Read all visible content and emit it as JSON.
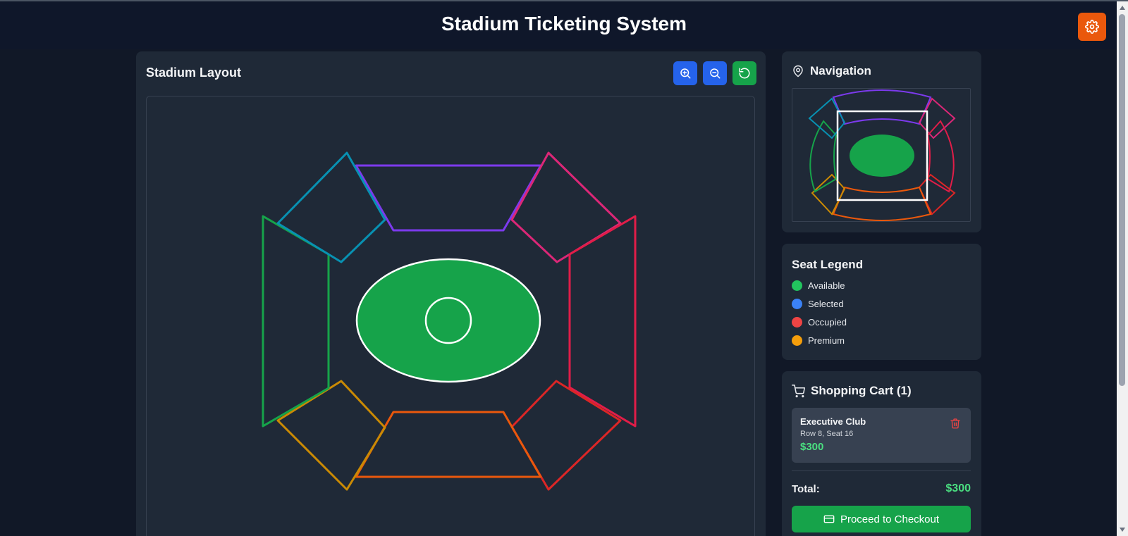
{
  "app": {
    "title": "Stadium Ticketing System"
  },
  "layout": {
    "title": "Stadium Layout",
    "controls": {
      "zoom_in": "zoom-in-icon",
      "zoom_out": "zoom-out-icon",
      "reset": "reset-icon"
    }
  },
  "navigation": {
    "title": "Navigation",
    "icon": "map-pin-icon"
  },
  "legend": {
    "title": "Seat Legend",
    "items": [
      {
        "label": "Available",
        "color": "#22c55e"
      },
      {
        "label": "Selected",
        "color": "#3b82f6"
      },
      {
        "label": "Occupied",
        "color": "#ef4444"
      },
      {
        "label": "Premium",
        "color": "#f59e0b"
      }
    ]
  },
  "cart": {
    "title": "Shopping Cart (1)",
    "icon": "cart-icon",
    "items": [
      {
        "name": "Executive Club",
        "seat": "Row 8, Seat 16",
        "price": "$300"
      }
    ],
    "total_label": "Total:",
    "total_value": "$300",
    "checkout_label": "Proceed to Checkout"
  },
  "colors": {
    "accent": "#2563eb",
    "success": "#16a34a",
    "settings": "#ea580c",
    "field": "#16a34a",
    "sections": {
      "north": "#7c3aed",
      "north_east": "#db2777",
      "east": "#e11d48",
      "south_east": "#dc2626",
      "south": "#ea580c",
      "south_west": "#ca8a04",
      "west": "#16a34a",
      "north_west": "#0891b2"
    }
  }
}
